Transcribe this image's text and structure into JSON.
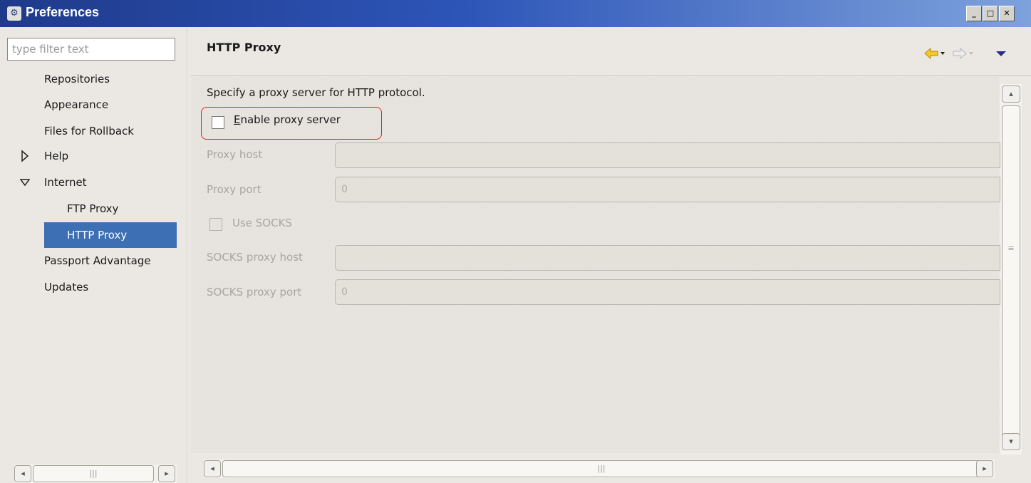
{
  "window": {
    "title": "Preferences",
    "icon": "preferences-app-icon",
    "controls": [
      "minimize",
      "maximize",
      "close"
    ]
  },
  "filter": {
    "placeholder": "type filter text",
    "value": ""
  },
  "tree": {
    "items": [
      {
        "label": "Repositories",
        "level": 0,
        "expandable": false
      },
      {
        "label": "Appearance",
        "level": 0,
        "expandable": false
      },
      {
        "label": "Files for Rollback",
        "level": 0,
        "expandable": false
      },
      {
        "label": "Help",
        "level": 0,
        "expandable": true,
        "expanded": false
      },
      {
        "label": "Internet",
        "level": 0,
        "expandable": true,
        "expanded": true
      },
      {
        "label": "FTP Proxy",
        "level": 1,
        "expandable": false
      },
      {
        "label": "HTTP Proxy",
        "level": 1,
        "expandable": false,
        "selected": true
      },
      {
        "label": "Passport Advantage",
        "level": 0,
        "expandable": false
      },
      {
        "label": "Updates",
        "level": 0,
        "expandable": false
      }
    ]
  },
  "page": {
    "title": "HTTP Proxy",
    "description": "Specify a proxy server for HTTP protocol.",
    "enable_proxy": {
      "label_mnemonic": "E",
      "label_rest": "nable proxy server",
      "checked": false
    },
    "proxy_host": {
      "label": "Proxy host",
      "value": "",
      "enabled": false
    },
    "proxy_port": {
      "label": "Proxy port",
      "value": "0",
      "enabled": false
    },
    "use_socks": {
      "label": "Use SOCKS",
      "checked": false,
      "enabled": false
    },
    "socks_host": {
      "label": "SOCKS proxy host",
      "value": "",
      "enabled": false
    },
    "socks_port": {
      "label": "SOCKS proxy port",
      "value": "0",
      "enabled": false
    }
  },
  "toolbar": {
    "back_icon": "back-arrow-icon",
    "forward_icon": "forward-arrow-icon",
    "menu_icon": "view-menu-icon"
  },
  "colors": {
    "selection": "#3d6fb4",
    "highlight_border": "#e0231b",
    "title_bar": "#2d55b8",
    "back_arrow": "#e8b416"
  }
}
